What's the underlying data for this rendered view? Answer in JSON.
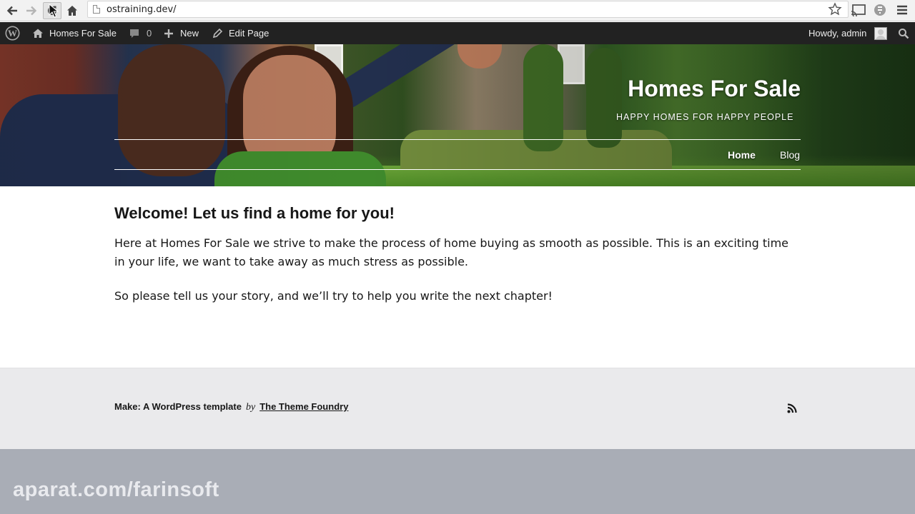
{
  "browser": {
    "url": "ostraining.dev/"
  },
  "admin_bar": {
    "site_name": "Homes For Sale",
    "comments_count": "0",
    "new_label": "New",
    "edit_label": "Edit Page",
    "howdy": "Howdy, admin",
    "background": "#222222"
  },
  "header": {
    "title": "Homes For Sale",
    "tagline": "HAPPY HOMES FOR HAPPY PEOPLE",
    "nav": [
      {
        "label": "Home",
        "active": true
      },
      {
        "label": "Blog",
        "active": false
      }
    ]
  },
  "content": {
    "heading": "Welcome! Let us find a home for you!",
    "paragraphs": [
      "Here at Homes For Sale we strive to make the process of home buying as smooth as possible.  This is an exciting time in your life, we want to take away as much stress as possible.",
      "So please tell us your story, and we’ll try to help you write the next chapter!"
    ]
  },
  "footer": {
    "theme_name": "Make: A WordPress template",
    "by": "by",
    "author": "The Theme Foundry",
    "background": "#eaeaec"
  },
  "watermark": "aparat.com/farinsoft"
}
